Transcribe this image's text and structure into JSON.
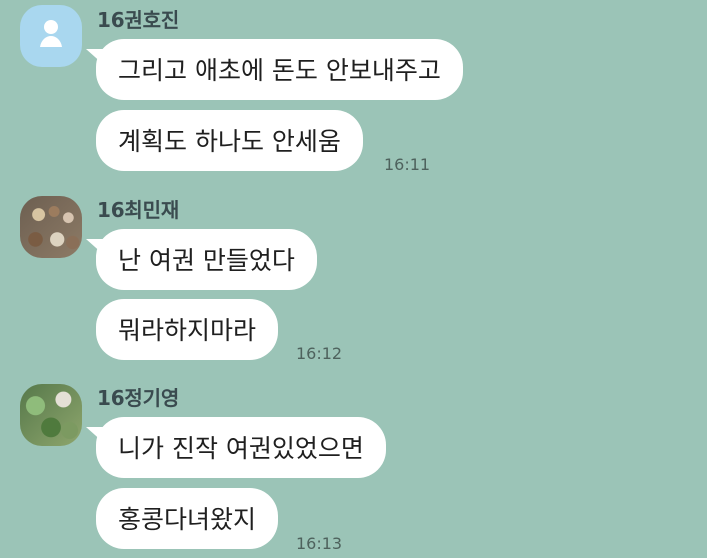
{
  "messages": [
    {
      "sender": "16권호진",
      "lines": [
        "그리고 애초에 돈도 안보내주고",
        "계획도 하나도 안세움"
      ],
      "time": "16:11"
    },
    {
      "sender": "16최민재",
      "lines": [
        "난 여권 만들었다",
        "뭐라하지마라"
      ],
      "time": "16:12"
    },
    {
      "sender": "16정기영",
      "lines": [
        "니가 진작 여권있었으면",
        "홍콩다녀왔지"
      ],
      "time": "16:13"
    }
  ],
  "colors": {
    "background": "#9bc4b7",
    "bubble": "#ffffff",
    "text": "#1f1f1f",
    "name": "#3a4b4f",
    "time": "#4e625d",
    "default_avatar": "#a9d7ef"
  }
}
